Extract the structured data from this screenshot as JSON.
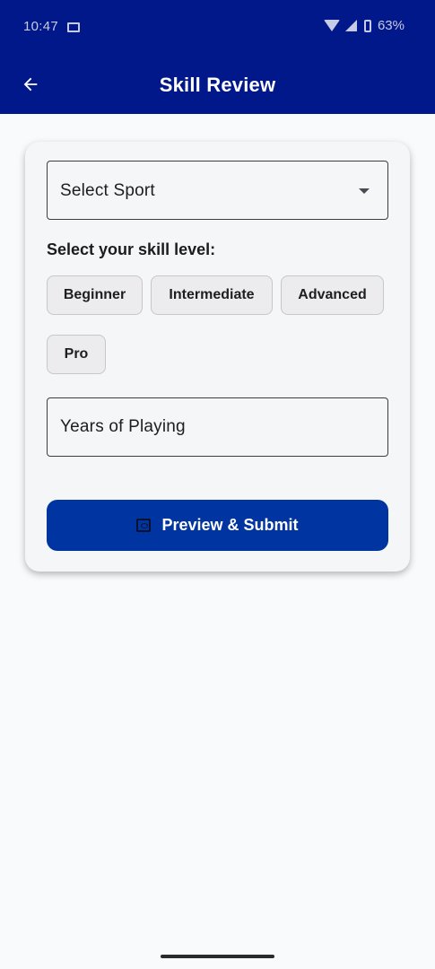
{
  "status_bar": {
    "time": "10:47",
    "battery": "63%",
    "icons": [
      "message-icon",
      "wifi-icon",
      "signal-icon",
      "battery-icon"
    ]
  },
  "app_bar": {
    "title": "Skill Review",
    "back_icon": "arrow-left-icon"
  },
  "form": {
    "sport_select": {
      "label": "Select Sport",
      "icon": "dropdown-arrow-icon"
    },
    "skill_heading": "Select your skill level:",
    "skill_levels": [
      "Beginner",
      "Intermediate",
      "Advanced",
      "Pro"
    ],
    "years_field": {
      "placeholder": "Years of Playing"
    },
    "submit_button": {
      "label": "Preview & Submit",
      "icon": "preview-icon"
    }
  },
  "colors": {
    "primary": "#00188a",
    "button": "#0034a0",
    "background": "#f9fafb"
  }
}
